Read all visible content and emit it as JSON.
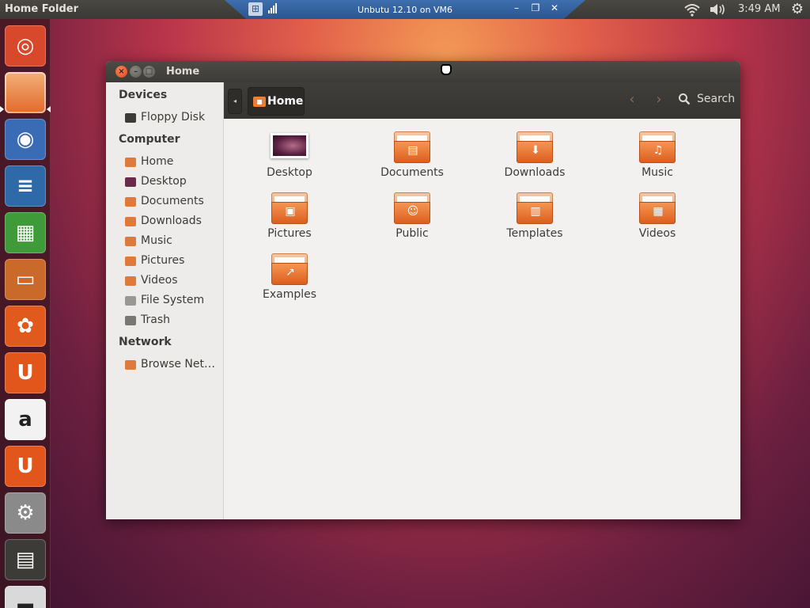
{
  "top_panel": {
    "app_title": "Home Folder",
    "vm_label": "Unbutu 12.10 on VM6",
    "clock": "3:49 AM"
  },
  "launcher": {
    "items": [
      {
        "name": "dash-home-icon",
        "glyph": "◎",
        "bg": "#d8492b"
      },
      {
        "name": "files-icon",
        "glyph": "",
        "bg": "#e8873e"
      },
      {
        "name": "firefox-icon",
        "glyph": "◉",
        "bg": "#3a6bb5"
      },
      {
        "name": "writer-icon",
        "glyph": "≡",
        "bg": "#2f6aa8"
      },
      {
        "name": "calc-icon",
        "glyph": "▦",
        "bg": "#3f9a3a"
      },
      {
        "name": "impress-icon",
        "glyph": "▭",
        "bg": "#c96a2a"
      },
      {
        "name": "software-center-icon",
        "glyph": "✿",
        "bg": "#e05a1e"
      },
      {
        "name": "ubuntu-one-icon",
        "glyph": "U",
        "bg": "#e2561c"
      },
      {
        "name": "amazon-icon",
        "glyph": "a",
        "bg": "#f2f2f2"
      },
      {
        "name": "ubuntu-one-music-icon",
        "glyph": "U",
        "bg": "#e2561c"
      },
      {
        "name": "system-settings-icon",
        "glyph": "⚙",
        "bg": "#8a8a8a"
      },
      {
        "name": "workspace-switcher-icon",
        "glyph": "▤",
        "bg": "#3c3b37"
      },
      {
        "name": "trash-launcher-icon",
        "glyph": "▬",
        "bg": "#d9d9d9"
      }
    ]
  },
  "window": {
    "title": "Home",
    "close_glyph": "×",
    "min_glyph": "–",
    "max_glyph": "□",
    "breadcrumb": "Home",
    "back_arrow": "‹",
    "forward_arrow": "›",
    "search_label": "Search"
  },
  "sidebar": {
    "sections": [
      {
        "heading": "Devices",
        "items": [
          {
            "label": "Floppy Disk",
            "icon": "floppy-icon",
            "color": "#3c3b37"
          }
        ]
      },
      {
        "heading": "Computer",
        "items": [
          {
            "label": "Home",
            "icon": "home-icon",
            "color": "#e07a3a"
          },
          {
            "label": "Desktop",
            "icon": "desktop-icon",
            "color": "#6a2a4a"
          },
          {
            "label": "Documents",
            "icon": "documents-icon",
            "color": "#e07a3a"
          },
          {
            "label": "Downloads",
            "icon": "downloads-icon",
            "color": "#e07a3a"
          },
          {
            "label": "Music",
            "icon": "music-icon",
            "color": "#e07a3a"
          },
          {
            "label": "Pictures",
            "icon": "pictures-icon",
            "color": "#e07a3a"
          },
          {
            "label": "Videos",
            "icon": "videos-icon",
            "color": "#e07a3a"
          },
          {
            "label": "File System",
            "icon": "filesystem-icon",
            "color": "#9a9893"
          },
          {
            "label": "Trash",
            "icon": "trash-icon",
            "color": "#7a7873"
          }
        ]
      },
      {
        "heading": "Network",
        "items": [
          {
            "label": "Browse Net…",
            "icon": "network-icon",
            "color": "#e07a3a"
          }
        ]
      }
    ]
  },
  "files": [
    {
      "label": "Desktop",
      "icon": "desktop-thumb-icon",
      "kind": "desktop",
      "emblem": ""
    },
    {
      "label": "Documents",
      "icon": "documents-folder-icon",
      "kind": "folder",
      "emblem": "▤"
    },
    {
      "label": "Downloads",
      "icon": "downloads-folder-icon",
      "kind": "folder",
      "emblem": "⬇"
    },
    {
      "label": "Music",
      "icon": "music-folder-icon",
      "kind": "folder",
      "emblem": "♫"
    },
    {
      "label": "Pictures",
      "icon": "pictures-folder-icon",
      "kind": "folder",
      "emblem": "▣"
    },
    {
      "label": "Public",
      "icon": "public-folder-icon",
      "kind": "folder",
      "emblem": "☺"
    },
    {
      "label": "Templates",
      "icon": "templates-folder-icon",
      "kind": "folder",
      "emblem": "▥"
    },
    {
      "label": "Videos",
      "icon": "videos-folder-icon",
      "kind": "folder",
      "emblem": "▦"
    },
    {
      "label": "Examples",
      "icon": "examples-folder-icon",
      "kind": "folder",
      "emblem": "↗"
    }
  ]
}
